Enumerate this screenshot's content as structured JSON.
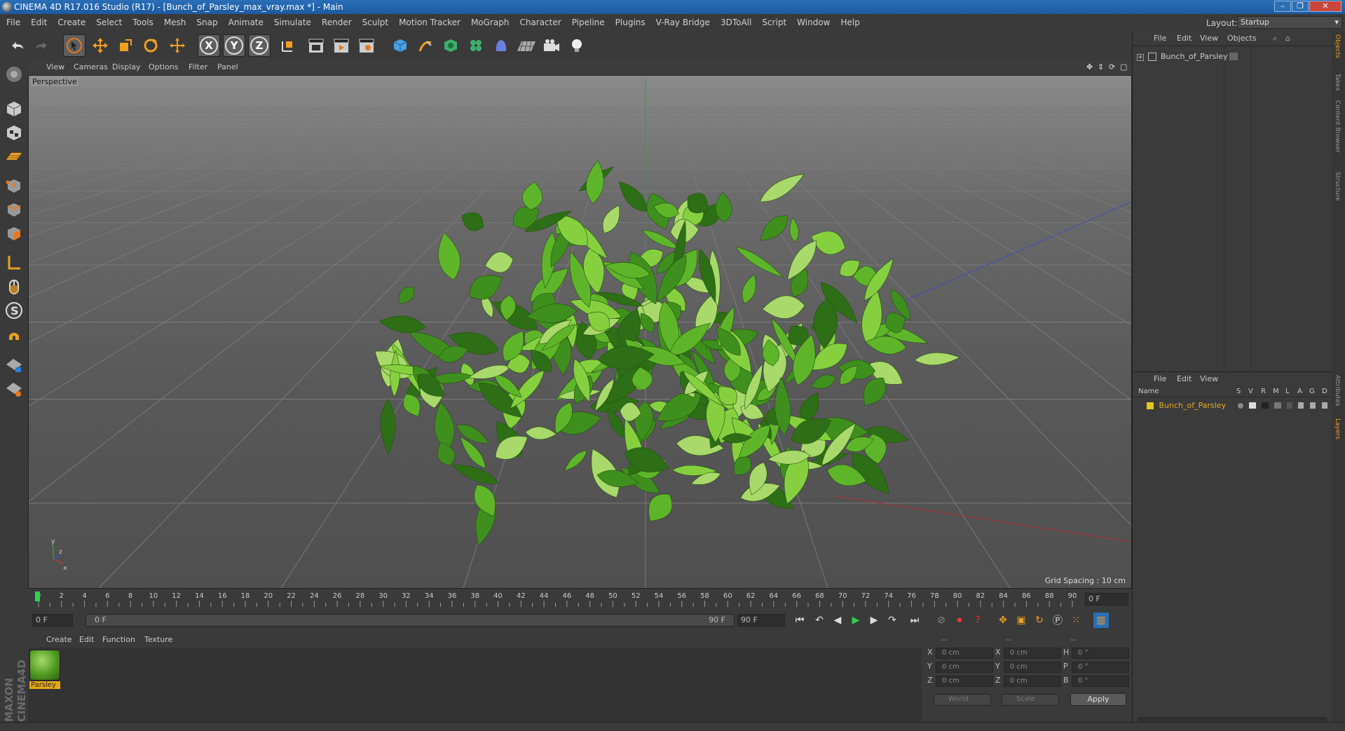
{
  "window": {
    "title": "CINEMA 4D R17.016 Studio (R17) - [Bunch_of_Parsley_max_vray.max *] - Main",
    "controls": [
      "–",
      "❐",
      "✕"
    ]
  },
  "menubar": [
    "File",
    "Edit",
    "Create",
    "Select",
    "Tools",
    "Mesh",
    "Snap",
    "Animate",
    "Simulate",
    "Render",
    "Sculpt",
    "Motion Tracker",
    "MoGraph",
    "Character",
    "Pipeline",
    "Plugins",
    "V-Ray Bridge",
    "3DToAll",
    "Script",
    "Window",
    "Help"
  ],
  "layout": {
    "label": "Layout:",
    "value": "Startup"
  },
  "toolbar": {
    "axis_x": "X",
    "axis_y": "Y",
    "axis_z": "Z"
  },
  "viewport": {
    "menu": [
      "View",
      "Cameras",
      "Display",
      "Options",
      "Filter",
      "Panel"
    ],
    "label": "Perspective",
    "grid_spacing": "Grid Spacing : 10 cm",
    "grid_color": "#7a7a7a",
    "foliage_colors": [
      "#3f8f1e",
      "#5fb52a",
      "#86d040",
      "#2e6e16",
      "#a8d96a"
    ]
  },
  "timeline": {
    "ticks": [
      "0",
      "2",
      "4",
      "6",
      "8",
      "10",
      "12",
      "14",
      "16",
      "18",
      "20",
      "22",
      "24",
      "26",
      "28",
      "30",
      "32",
      "34",
      "36",
      "38",
      "40",
      "42",
      "44",
      "46",
      "48",
      "50",
      "52",
      "54",
      "56",
      "58",
      "60",
      "62",
      "64",
      "66",
      "68",
      "70",
      "72",
      "74",
      "76",
      "78",
      "80",
      "82",
      "84",
      "86",
      "88",
      "90"
    ],
    "current_frame": "0 F"
  },
  "transport": {
    "start": "0 F",
    "range_start": "0 F",
    "range_end": "90 F",
    "end": "90 F"
  },
  "material_panel": {
    "menu": [
      "Create",
      "Edit",
      "Function",
      "Texture"
    ],
    "materials": [
      {
        "name": "Parsley"
      }
    ]
  },
  "branding": {
    "logo_text": "MAXON CINEMA4D"
  },
  "coordinates": {
    "headers": [
      "--",
      "--",
      "--"
    ],
    "rows": [
      {
        "a": "X",
        "v1": "0 cm",
        "b": "X",
        "v2": "0 cm",
        "c": "H",
        "v3": "0 °"
      },
      {
        "a": "Y",
        "v1": "0 cm",
        "b": "Y",
        "v2": "0 cm",
        "c": "P",
        "v3": "0 °"
      },
      {
        "a": "Z",
        "v1": "0 cm",
        "b": "Z",
        "v2": "0 cm",
        "c": "B",
        "v3": "0 °"
      }
    ],
    "mode1": "World",
    "mode2": "Scale",
    "apply": "Apply"
  },
  "object_manager": {
    "menu": [
      "File",
      "Edit",
      "View",
      "Objects"
    ],
    "objects": [
      {
        "name": "Bunch_of_Parsley"
      }
    ]
  },
  "layer_manager": {
    "menu": [
      "File",
      "Edit",
      "View"
    ],
    "columns": {
      "name": "Name",
      "flags": [
        "S",
        "V",
        "R",
        "M",
        "L",
        "A",
        "G",
        "D"
      ]
    },
    "layers": [
      {
        "name": "Bunch_of_Parsley",
        "color": "#e6c619"
      }
    ]
  },
  "side_tabs": [
    "Objects",
    "Takes",
    "Content Browser",
    "Structure",
    "Attributes",
    "Layers"
  ]
}
